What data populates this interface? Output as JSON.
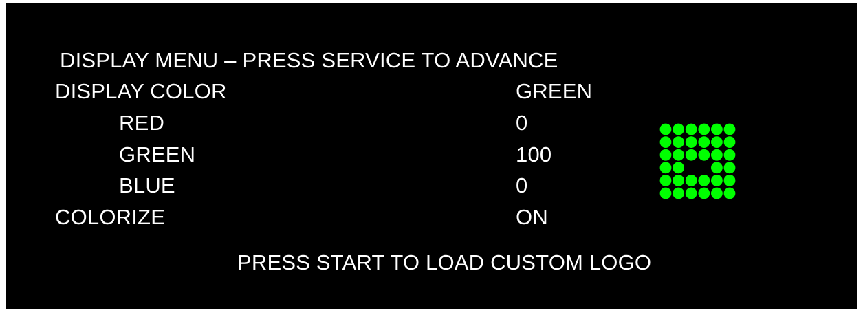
{
  "menu": {
    "title": "DISPLAY MENU – PRESS SERVICE TO ADVANCE",
    "rows": [
      {
        "label": "DISPLAY COLOR",
        "value": "GREEN"
      },
      {
        "label": "RED",
        "value": "0"
      },
      {
        "label": "GREEN",
        "value": "100"
      },
      {
        "label": "BLUE",
        "value": "0"
      },
      {
        "label": "COLORIZE",
        "value": "ON"
      }
    ],
    "footer": "PRESS START TO LOAD CUSTOM LOGO"
  },
  "preview": {
    "icon": "dot-matrix-preview",
    "color": "#00ff00",
    "background": "#000000",
    "grid": [
      "111111",
      "111111",
      "111111",
      "110011",
      "111111",
      "111111"
    ]
  }
}
